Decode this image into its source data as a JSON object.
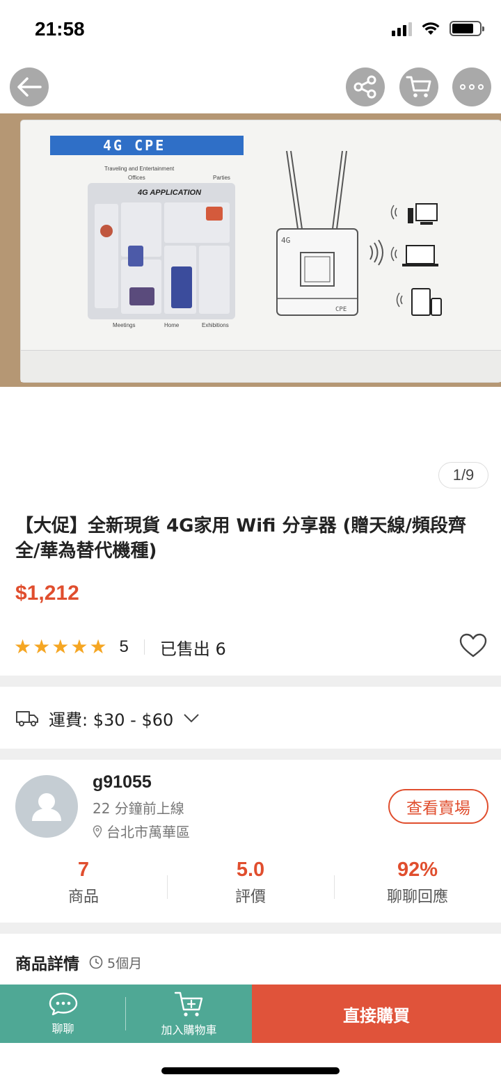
{
  "status_bar": {
    "time": "21:58"
  },
  "hero": {
    "banner_text": "4G CPE",
    "app_title": "4G APPLICATION",
    "labels": [
      "Traveling and Entertainment",
      "Offices",
      "Parties",
      "Meetings",
      "Home",
      "Exhibitions"
    ],
    "device_label_top": "4G",
    "device_label_bottom": "CPE"
  },
  "gallery": {
    "page_indicator": "1/9"
  },
  "product": {
    "title": "【大促】全新現貨 4G家用 Wifi 分享器 (贈天線/頻段齊全/華為替代機種)",
    "price": "$1,212",
    "rating_value": "5",
    "rating_stars": 5,
    "sold_text": "已售出 6"
  },
  "shipping": {
    "text": "運費: $30 - $60"
  },
  "seller": {
    "name": "g91055",
    "online": "22 分鐘前上線",
    "location": "台北市萬華區",
    "view_shop_label": "查看賣場",
    "stats": [
      {
        "value": "7",
        "label": "商品"
      },
      {
        "value": "5.0",
        "label": "評價"
      },
      {
        "value": "92%",
        "label": "聊聊回應"
      }
    ]
  },
  "details": {
    "title": "商品詳情",
    "age": "5個月"
  },
  "bottom_bar": {
    "chat_label": "聊聊",
    "add_to_cart_label": "加入購物車",
    "buy_now_label": "直接購買"
  },
  "colors": {
    "accent": "#e04e2e",
    "bottom_left": "#4fa895",
    "bottom_right": "#e0533a",
    "star": "#f5a623"
  }
}
